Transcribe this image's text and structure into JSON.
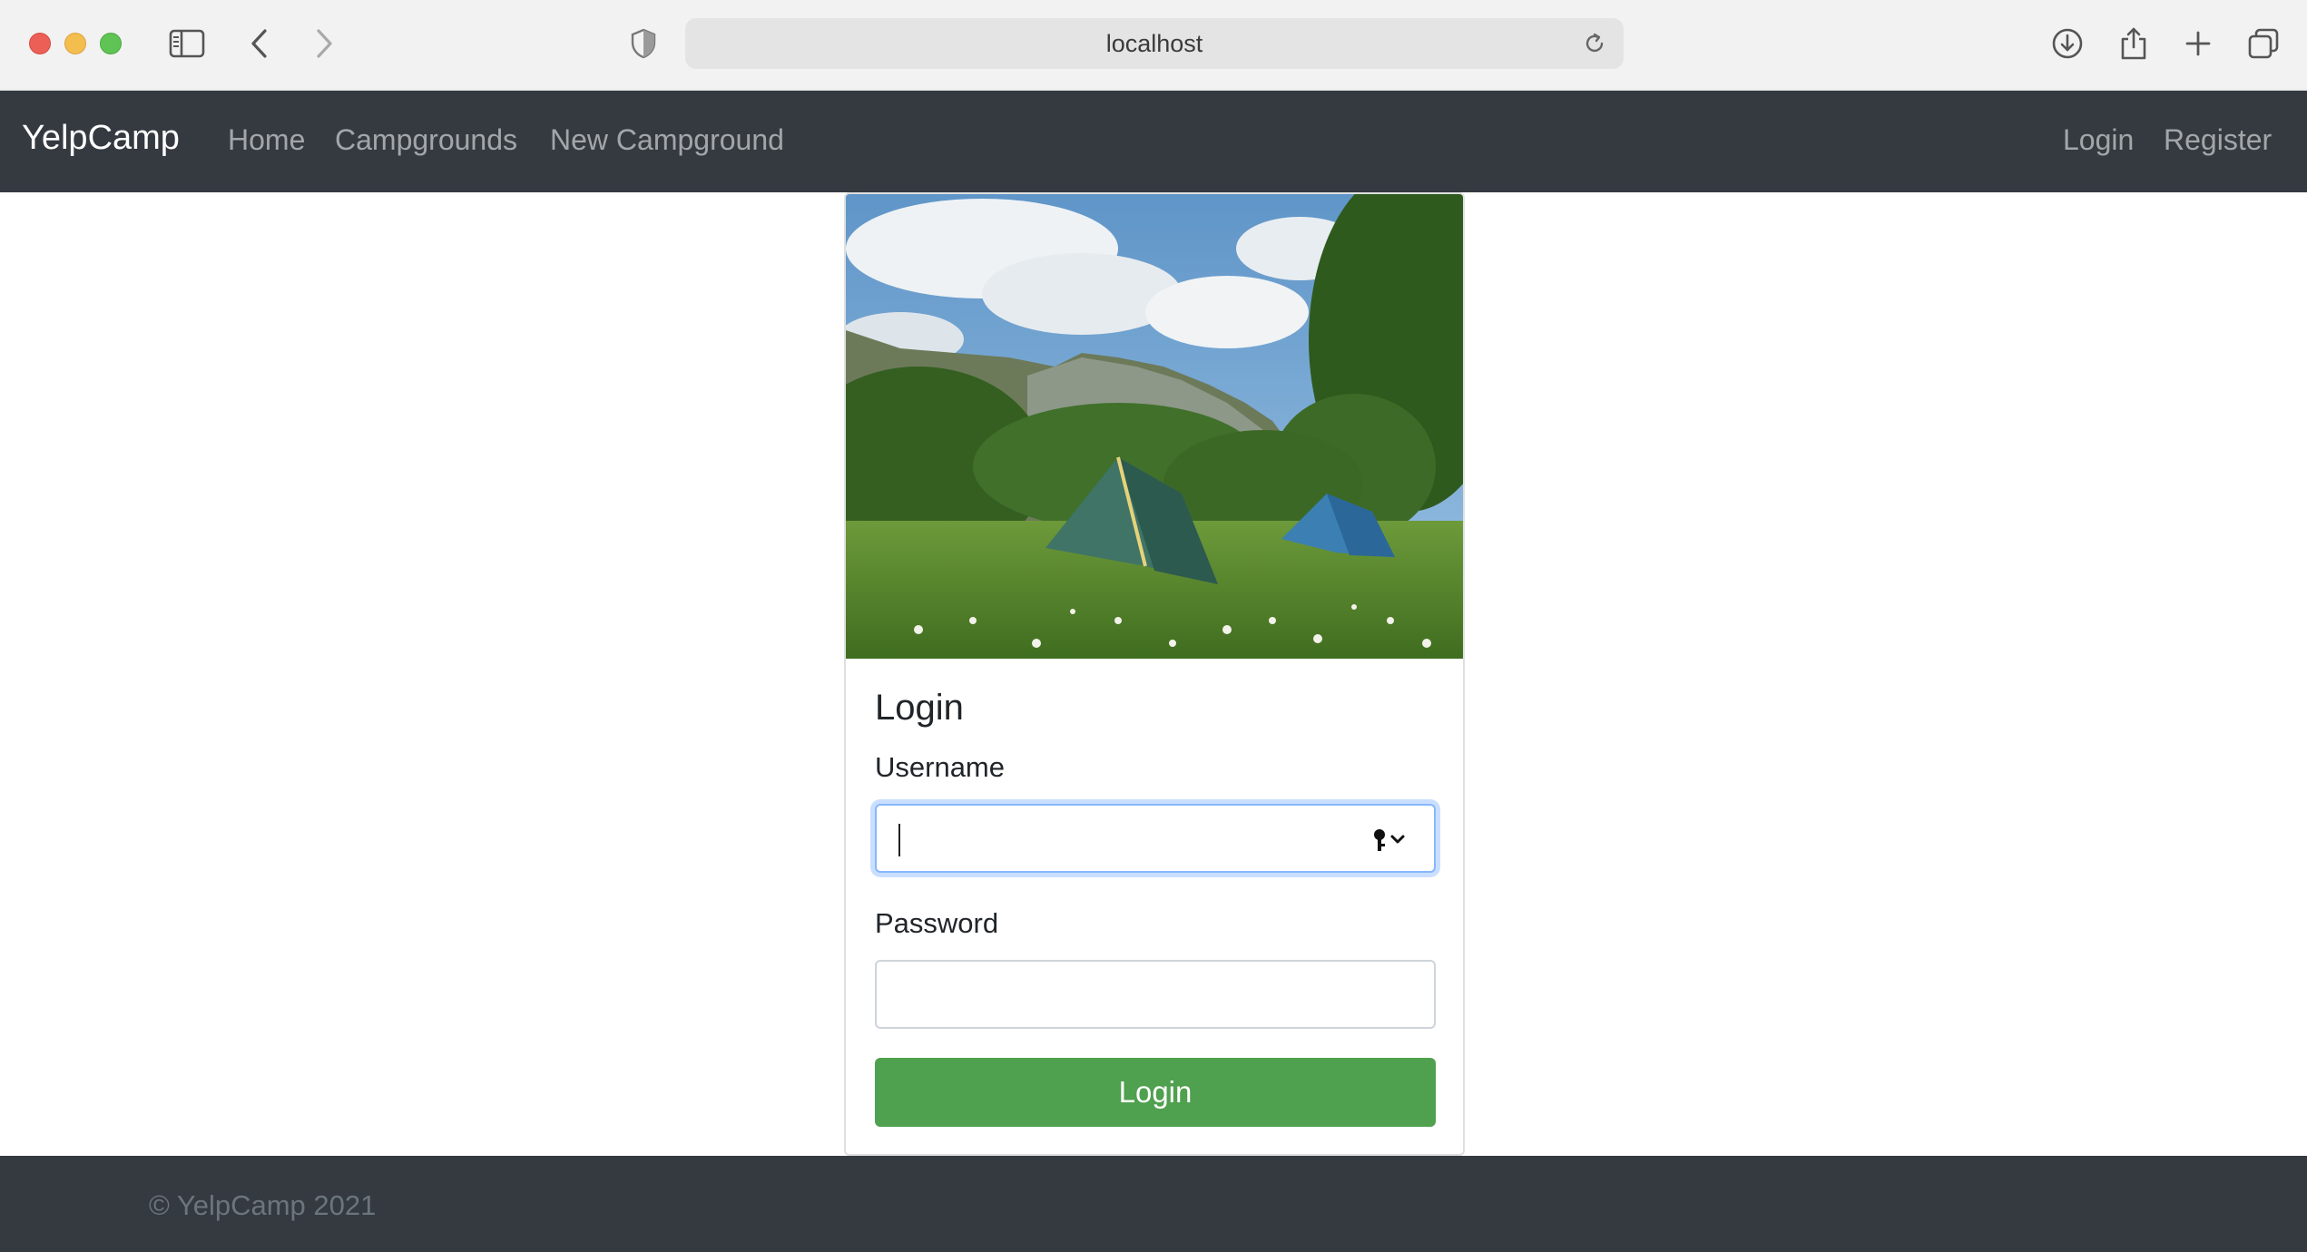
{
  "browser": {
    "url": "localhost",
    "icons": [
      "sidebar-icon",
      "back-icon",
      "forward-icon",
      "shield-icon",
      "reload-icon",
      "download-icon",
      "share-icon",
      "new-tab-icon",
      "tab-overview-icon"
    ]
  },
  "navbar": {
    "brand": "YelpCamp",
    "links": [
      {
        "label": "Home"
      },
      {
        "label": "Campgrounds"
      },
      {
        "label": "New Campground"
      }
    ],
    "auth": [
      {
        "label": "Login"
      },
      {
        "label": "Register"
      }
    ],
    "background": "#343a40"
  },
  "card": {
    "image_alt": "Two tents on a grassy meadow below mountains",
    "title": "Login",
    "username": {
      "label": "Username",
      "value": "",
      "placeholder": ""
    },
    "password": {
      "label": "Password",
      "value": "",
      "placeholder": ""
    },
    "submit_label": "Login",
    "submit_color": "#4fa04f"
  },
  "footer": {
    "text": "© YelpCamp 2021"
  }
}
